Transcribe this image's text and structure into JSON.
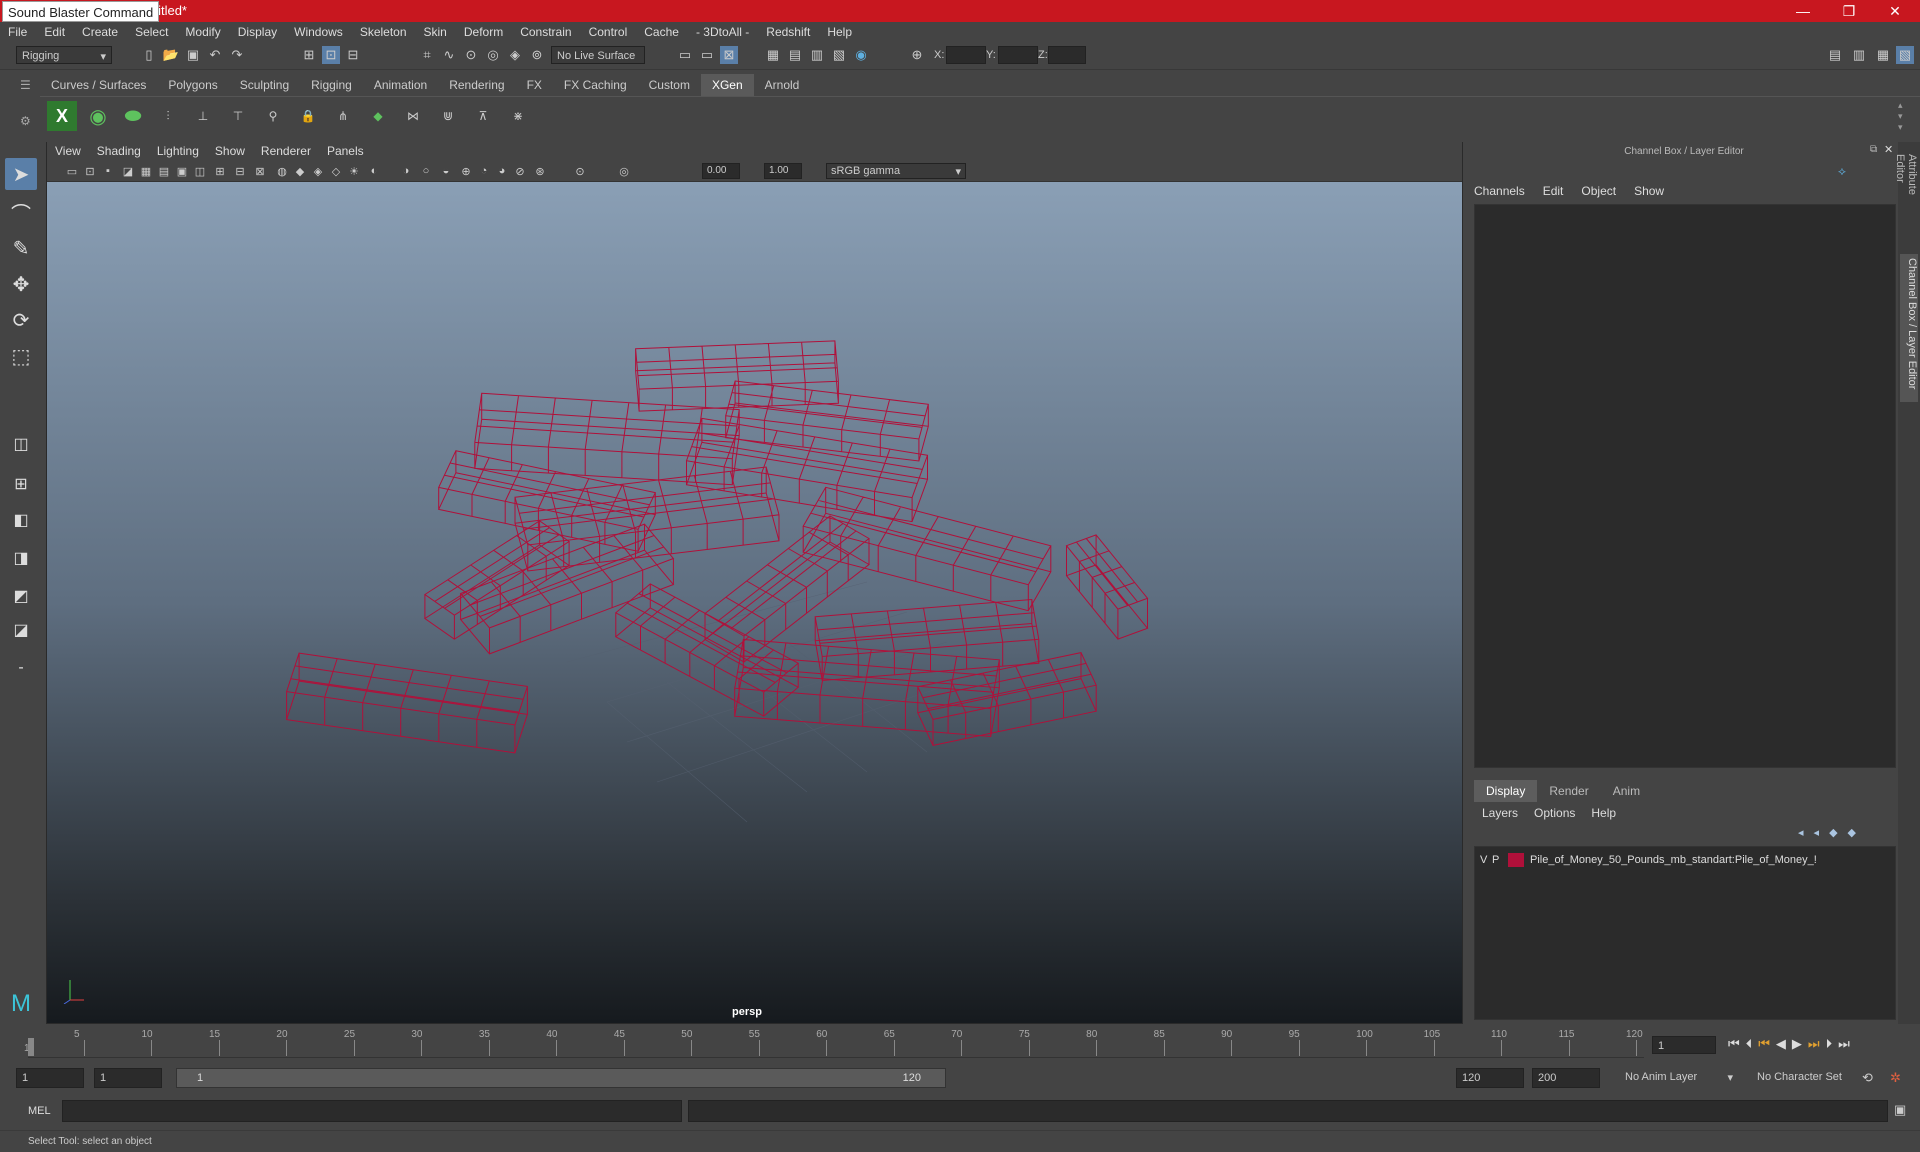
{
  "window": {
    "tooltip": "Sound Blaster Command",
    "title": "untitled*",
    "minimize": "—",
    "restore": "❐",
    "close": "✕"
  },
  "menubar": [
    "File",
    "Edit",
    "Create",
    "Select",
    "Modify",
    "Display",
    "Windows",
    "Skeleton",
    "Skin",
    "Deform",
    "Constrain",
    "Control",
    "Cache",
    "- 3DtoAll -",
    "Redshift",
    "Help"
  ],
  "statusline": {
    "mode": "Rigging",
    "live_surface": "No Live Surface",
    "x_label": "X:",
    "y_label": "Y:",
    "z_label": "Z:"
  },
  "shelf_tabs": [
    "Curves / Surfaces",
    "Polygons",
    "Sculpting",
    "Rigging",
    "Animation",
    "Rendering",
    "FX",
    "FX Caching",
    "Custom",
    "XGen",
    "Arnold"
  ],
  "shelf_active": "XGen",
  "viewport": {
    "menu": [
      "View",
      "Shading",
      "Lighting",
      "Show",
      "Renderer",
      "Panels"
    ],
    "exposure": "0.00",
    "gamma": "1.00",
    "colorspace": "sRGB gamma",
    "camera": "persp"
  },
  "right_panel": {
    "title": "Channel Box / Layer Editor",
    "menu": [
      "Channels",
      "Edit",
      "Object",
      "Show"
    ],
    "layer_tabs": [
      "Display",
      "Render",
      "Anim"
    ],
    "layer_menu": [
      "Layers",
      "Options",
      "Help"
    ],
    "layer": {
      "v": "V",
      "p": "P",
      "name": "Pile_of_Money_50_Pounds_mb_standart:Pile_of_Money_!",
      "color": "#b0103a"
    },
    "side_tabs": [
      "Attribute Editor",
      "Channel Box / Layer Editor"
    ]
  },
  "timeline": {
    "ticks": [
      "1",
      "5",
      "10",
      "15",
      "20",
      "25",
      "30",
      "35",
      "40",
      "45",
      "50",
      "55",
      "60",
      "65",
      "70",
      "75",
      "80",
      "85",
      "90",
      "95",
      "100",
      "105",
      "110",
      "115",
      "120"
    ],
    "current": "1"
  },
  "range": {
    "start": "1",
    "anim_start": "1",
    "slider_start": "1",
    "slider_end": "120",
    "end": "120",
    "anim_end": "200",
    "anim_layer": "No Anim Layer",
    "char_set": "No Character Set"
  },
  "cmd": {
    "label": "MEL"
  },
  "help": "Select Tool: select an object",
  "colors": {
    "wire": "#b0103a",
    "title_bar": "#c8171f"
  }
}
